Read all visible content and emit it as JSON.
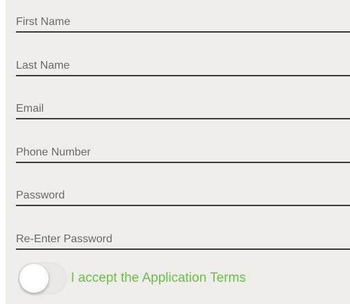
{
  "form": {
    "fields": [
      {
        "placeholder": "First Name",
        "value": ""
      },
      {
        "placeholder": "Last Name",
        "value": ""
      },
      {
        "placeholder": "Email",
        "value": ""
      },
      {
        "placeholder": "Phone Number",
        "value": ""
      },
      {
        "placeholder": "Password",
        "value": ""
      },
      {
        "placeholder": "Re-Enter Password",
        "value": ""
      }
    ],
    "terms": {
      "label": "I accept the Application Terms",
      "accepted": false
    }
  },
  "colors": {
    "background": "#efeeea",
    "underline": "#3a3a3a",
    "placeholder": "#6a6a6a",
    "accent": "#6cbf4a"
  },
  "icons": {
    "toggle": "toggle-switch-off"
  }
}
